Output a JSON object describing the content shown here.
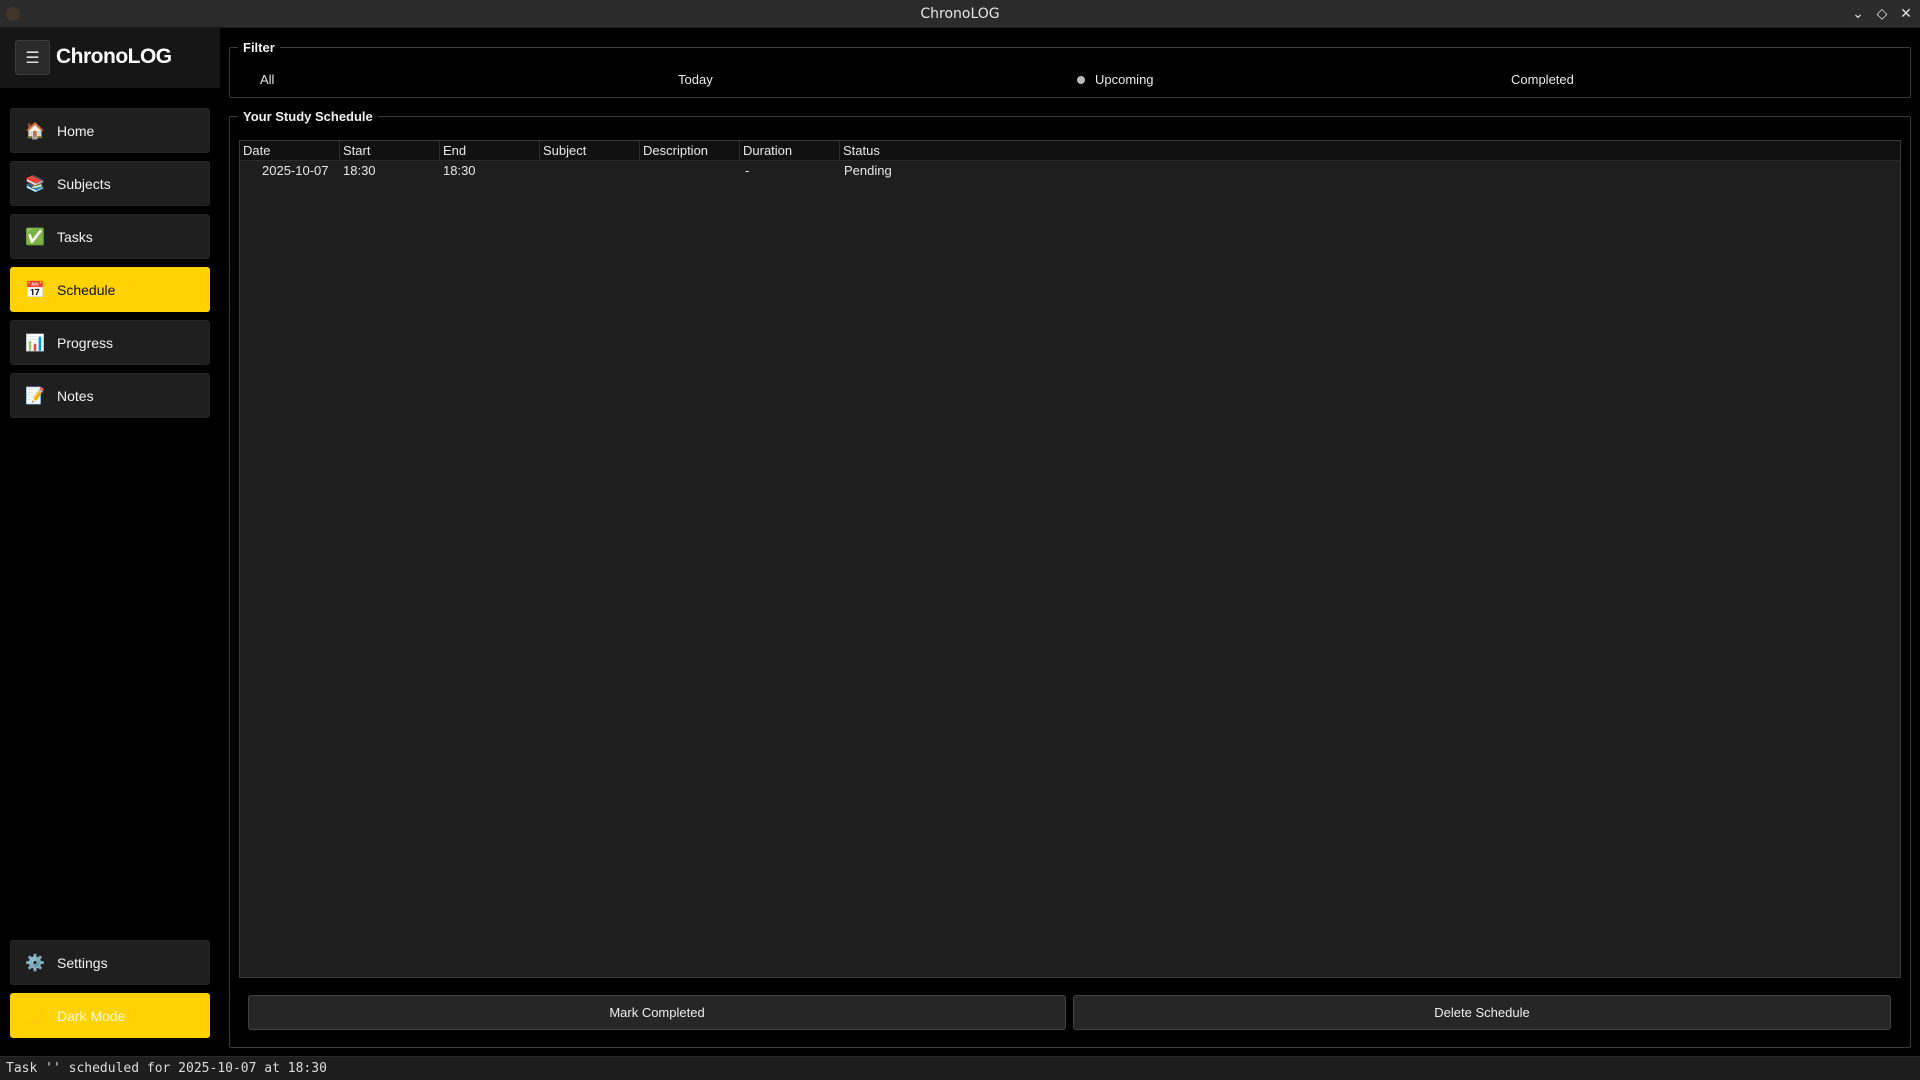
{
  "window": {
    "title": "ChronoLOG",
    "controls": [
      "minimize",
      "maximize",
      "close"
    ]
  },
  "sidebar": {
    "brand": "ChronoLOG",
    "items": [
      {
        "label": "Home",
        "icon": "🏠",
        "icon_name": "home-icon",
        "active": false
      },
      {
        "label": "Subjects",
        "icon": "📚",
        "icon_name": "books-icon",
        "active": false
      },
      {
        "label": "Tasks",
        "icon": "✅",
        "icon_name": "check-icon",
        "active": false
      },
      {
        "label": "Schedule",
        "icon": "📅",
        "icon_name": "calendar-icon",
        "active": true
      },
      {
        "label": "Progress",
        "icon": "📊",
        "icon_name": "chart-icon",
        "active": false
      },
      {
        "label": "Notes",
        "icon": "📝",
        "icon_name": "memo-icon",
        "active": false
      }
    ],
    "bottom": [
      {
        "label": "Settings",
        "icon": "⚙️",
        "icon_name": "gear-icon"
      },
      {
        "label": "Dark Mode",
        "icon": "🌙",
        "icon_name": "moon-icon"
      }
    ]
  },
  "filter": {
    "legend": "Filter",
    "options": [
      "All",
      "Today",
      "Upcoming",
      "Completed"
    ],
    "selected": "Upcoming"
  },
  "schedule": {
    "legend": "Your Study Schedule",
    "columns": [
      "Date",
      "Start",
      "End",
      "Subject",
      "Description",
      "Duration",
      "Status"
    ],
    "rows": [
      [
        "2025-10-07",
        "18:30",
        "18:30",
        "",
        "",
        "-",
        "Pending"
      ]
    ]
  },
  "actions": {
    "mark_completed": "Mark Completed",
    "delete_schedule": "Delete Schedule"
  },
  "status_bar": {
    "message": "Task '' scheduled for 2025-10-07 at 18:30"
  },
  "colors": {
    "accent": "#ffd200",
    "background": "#000000",
    "panel": "#1e1e1e"
  }
}
